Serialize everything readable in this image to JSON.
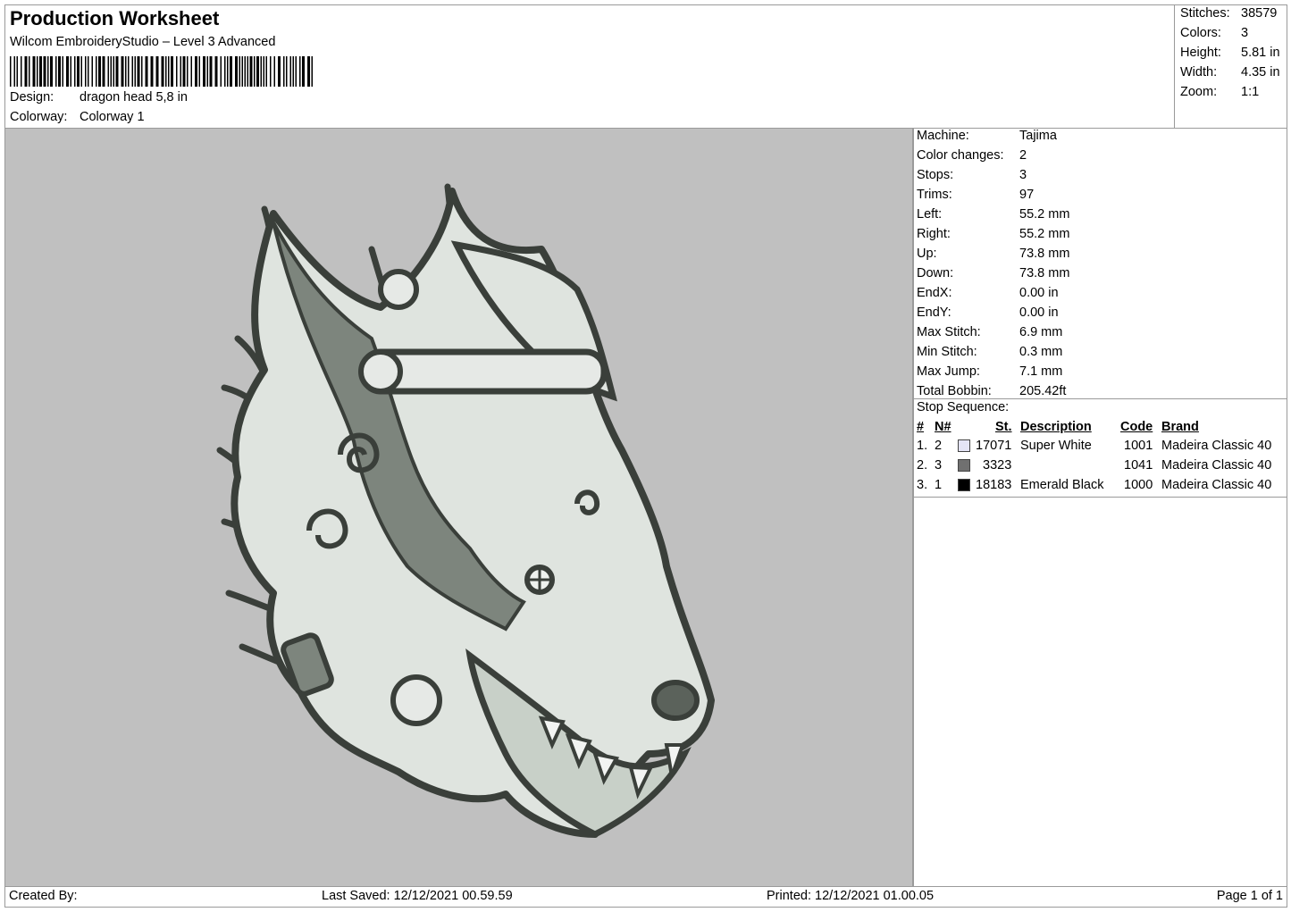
{
  "header": {
    "title": "Production Worksheet",
    "software": "Wilcom EmbroideryStudio – Level 3 Advanced",
    "design_label": "Design:",
    "design_value": "dragon head 5,8 in",
    "colorway_label": "Colorway:",
    "colorway_value": "Colorway 1"
  },
  "stats": [
    {
      "label": "Stitches:",
      "value": "38579"
    },
    {
      "label": "Colors:",
      "value": "3"
    },
    {
      "label": "Height:",
      "value": "5.81 in"
    },
    {
      "label": "Width:",
      "value": "4.35 in"
    },
    {
      "label": "Zoom:",
      "value": "1:1"
    }
  ],
  "params": [
    {
      "label": "Machine:",
      "value": "Tajima"
    },
    {
      "label": "Color changes:",
      "value": "2"
    },
    {
      "label": "Stops:",
      "value": "3"
    },
    {
      "label": "Trims:",
      "value": "97"
    },
    {
      "label": "Left:",
      "value": "55.2 mm"
    },
    {
      "label": "Right:",
      "value": "55.2 mm"
    },
    {
      "label": "Up:",
      "value": "73.8 mm"
    },
    {
      "label": "Down:",
      "value": "73.8 mm"
    },
    {
      "label": "EndX:",
      "value": "0.00 in"
    },
    {
      "label": "EndY:",
      "value": "0.00 in"
    },
    {
      "label": "Max Stitch:",
      "value": "6.9 mm"
    },
    {
      "label": "Min Stitch:",
      "value": "0.3 mm"
    },
    {
      "label": "Max Jump:",
      "value": "7.1 mm"
    },
    {
      "label": "Total Bobbin:",
      "value": "205.42ft"
    }
  ],
  "stop_sequence": {
    "title": "Stop Sequence:",
    "headers": {
      "num": "#",
      "n": "N#",
      "st": "St.",
      "description": "Description",
      "code": "Code",
      "brand": "Brand"
    },
    "rows": [
      {
        "num": "1.",
        "n": "2",
        "color": "#e4e4f6",
        "st": "17071",
        "description": "Super White",
        "code": "1001",
        "brand": "Madeira Classic 40"
      },
      {
        "num": "2.",
        "n": "3",
        "color": "#707070",
        "st": "3323",
        "description": "",
        "code": "1041",
        "brand": "Madeira Classic 40"
      },
      {
        "num": "3.",
        "n": "1",
        "color": "#000000",
        "st": "18183",
        "description": "Emerald Black",
        "code": "1000",
        "brand": "Madeira Classic 40"
      }
    ]
  },
  "footer": {
    "created_by": "Created By:",
    "last_saved": "Last Saved: 12/12/2021 00.59.59",
    "printed": "Printed: 12/12/2021 01.00.05",
    "page": "Page 1 of 1"
  },
  "colors": {
    "preview_bg": "#c0c0c0",
    "outline": "#3a3f3a",
    "fill_light": "#dfe4df",
    "fill_mid": "#7d857d"
  }
}
